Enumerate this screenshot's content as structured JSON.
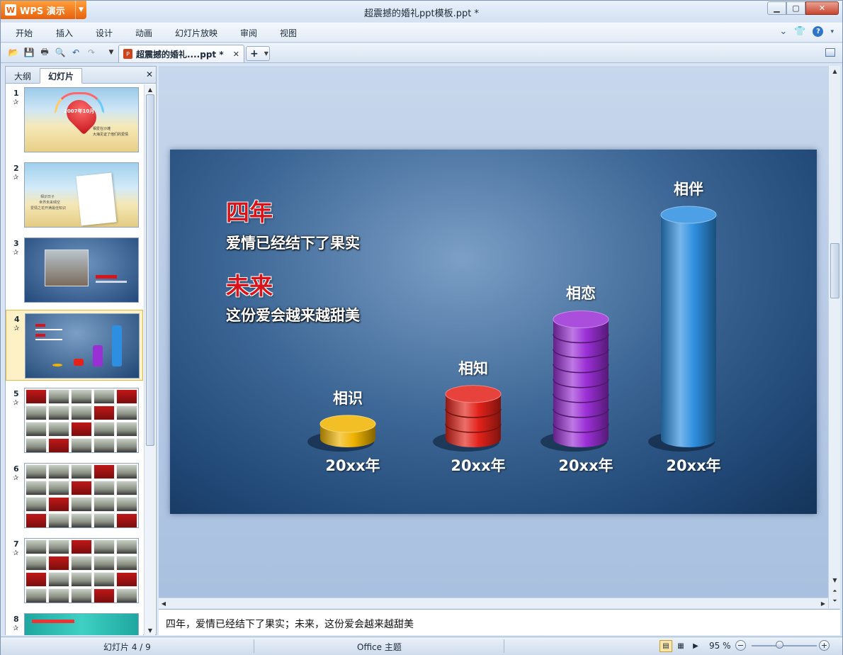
{
  "window": {
    "app_button": "WPS 演示",
    "title": "超震撼的婚礼ppt模板.ppt *",
    "min_icon": "minimize-icon",
    "max_icon": "maximize-icon",
    "close_icon": "close-icon"
  },
  "menu": {
    "items": [
      "开始",
      "插入",
      "设计",
      "动画",
      "幻灯片放映",
      "审阅",
      "视图"
    ]
  },
  "toolbar": {
    "doc_tab_label": "超震撼的婚礼....ppt *",
    "new_tab_label": "+"
  },
  "left_panel": {
    "tabs": [
      "大纲",
      "幻灯片"
    ],
    "active_tab": "幻灯片",
    "thumbnails": [
      {
        "num": "1",
        "text_a": "2007年10月",
        "text_b": "相爱在沙滩",
        "text_c": "大海见证了他们的爱情"
      },
      {
        "num": "2",
        "text_a": "相识日子",
        "text_b": "世界未来晴空",
        "text_c": "爱情之花开满最佳知识"
      },
      {
        "num": "3"
      },
      {
        "num": "4",
        "selected": true
      },
      {
        "num": "5"
      },
      {
        "num": "6"
      },
      {
        "num": "7"
      },
      {
        "num": "8"
      }
    ]
  },
  "slide": {
    "heading1": "四年",
    "line1": "爱情已经结下了果实",
    "heading2": "未来",
    "line2": "这份爱会越来越甜美",
    "colors": {
      "bg": "#2a5687",
      "heading": "#d8141a"
    }
  },
  "chart_data": {
    "type": "bar",
    "style": "3d-cylinder",
    "categories": [
      "相识",
      "相知",
      "相恋",
      "相伴"
    ],
    "x_labels": [
      "20xx年",
      "20xx年",
      "20xx年",
      "20xx年"
    ],
    "values": [
      1,
      3,
      8,
      15
    ],
    "colors": [
      "#f0b400",
      "#e3221a",
      "#9b2fd6",
      "#2e8fe0"
    ]
  },
  "notes": {
    "text": "四年，爱情已经结下了果实；未来，这份爱会越来越甜美"
  },
  "status": {
    "slide_counter": "幻灯片 4 / 9",
    "theme": "Office 主题",
    "zoom": "95 %",
    "zoom_fraction": 0.42
  }
}
